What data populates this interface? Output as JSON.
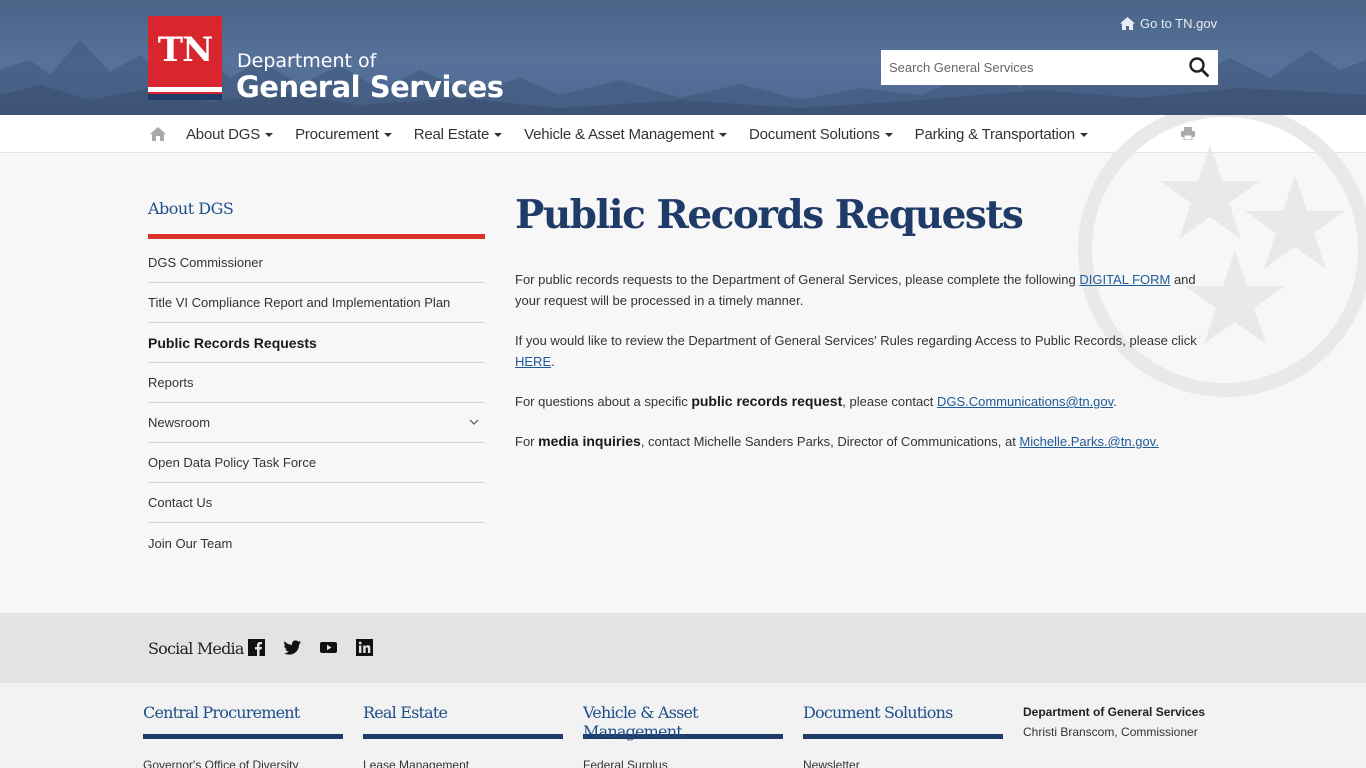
{
  "header": {
    "logo_text": "TN",
    "dept_line1": "Department of",
    "dept_line2": "General Services",
    "go_tn": "Go to TN.gov",
    "search_placeholder": "Search General Services"
  },
  "nav": {
    "items": [
      {
        "label": "About DGS"
      },
      {
        "label": "Procurement"
      },
      {
        "label": "Real Estate"
      },
      {
        "label": "Vehicle & Asset Management"
      },
      {
        "label": "Document Solutions"
      },
      {
        "label": "Parking & Transportation"
      }
    ]
  },
  "sidebar": {
    "title": "About DGS",
    "items": [
      {
        "label": "DGS Commissioner"
      },
      {
        "label": "Title VI Compliance Report and Implementation Plan"
      },
      {
        "label": "Public Records Requests",
        "active": true
      },
      {
        "label": "Reports"
      },
      {
        "label": "Newsroom",
        "expandable": true
      },
      {
        "label": "Open Data Policy Task Force"
      },
      {
        "label": "Contact Us"
      },
      {
        "label": "Join Our Team"
      }
    ]
  },
  "main": {
    "title": "Public Records Requests",
    "p1": {
      "pre": "For public records requests to the Department of General Services, please complete the following ",
      "link": "DIGITAL FORM",
      "post": " and your request will be processed in a timely manner."
    },
    "p2": {
      "pre": "If you would like to review the Department of General Services' Rules regarding Access to Public Records, please click ",
      "link": "HERE",
      "post": "."
    },
    "p3": {
      "pre": "For questions about a specific ",
      "bold": "public records request",
      "mid": ", please contact ",
      "link": "DGS.Communications@tn.gov",
      "post": "."
    },
    "p4": {
      "pre": "For ",
      "bold": "media inquiries",
      "mid": ", contact Michelle Sanders Parks, Director of Communications, at ",
      "link": "Michelle.Parks.@tn.gov."
    }
  },
  "social": {
    "label": "Social Media",
    "icons": [
      "facebook-icon",
      "twitter-icon",
      "youtube-icon",
      "linkedin-icon"
    ]
  },
  "footer": {
    "columns": [
      {
        "heading": "Central Procurement",
        "link": "Governor's Office of Diversity"
      },
      {
        "heading": "Real Estate",
        "link": "Lease Management"
      },
      {
        "heading": "Vehicle & Asset Management",
        "link": "Federal Surplus"
      },
      {
        "heading": "Document Solutions",
        "link": "Newsletter"
      }
    ],
    "info_name": "Department of General Services",
    "info_commissioner": "Christi Branscom, Commissioner"
  },
  "colors": {
    "header_bg": "#4f6a90",
    "brand_red": "#d8262e",
    "navy": "#1f3b68",
    "link": "#1f5a99"
  }
}
